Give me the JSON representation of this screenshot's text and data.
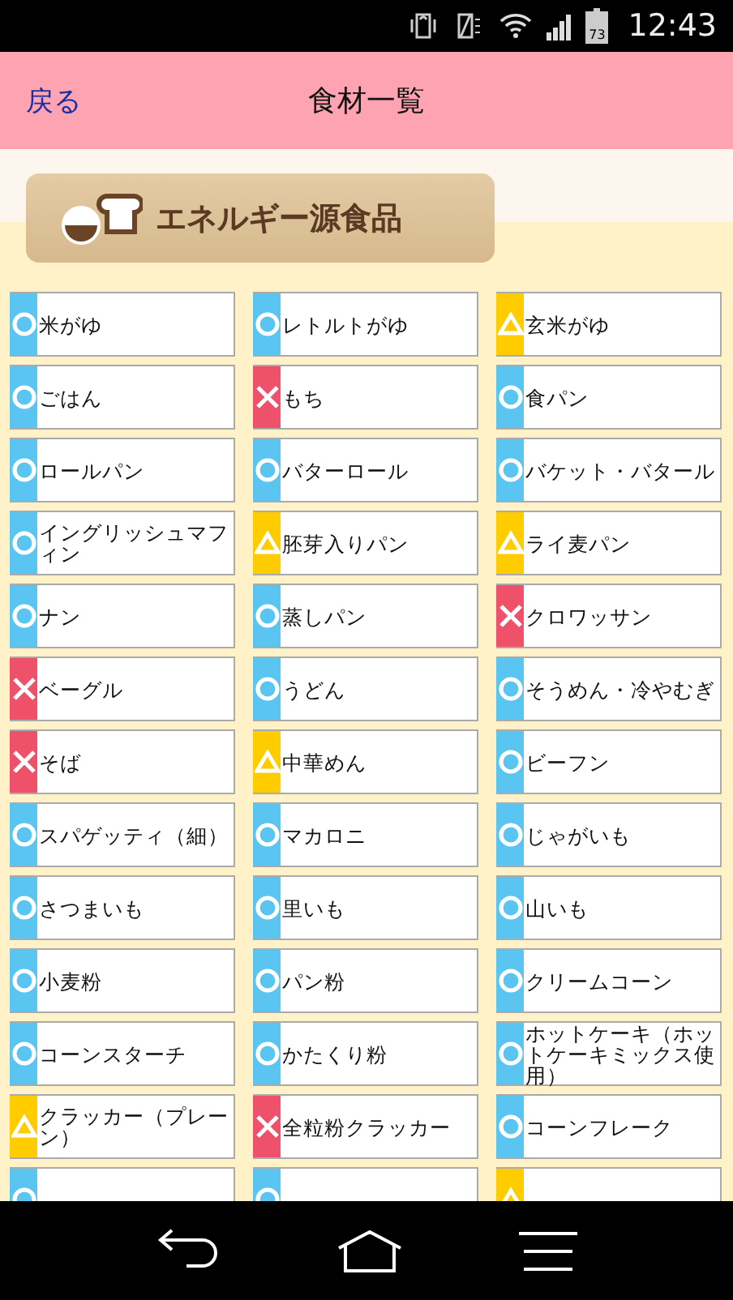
{
  "status_bar": {
    "battery": "73",
    "time": "12:43"
  },
  "header": {
    "back": "戻る",
    "title": "食材一覧"
  },
  "section": {
    "title": "エネルギー源食品"
  },
  "rows": [
    [
      {
        "name": "米がゆ",
        "kind": "ok"
      },
      {
        "name": "レトルトがゆ",
        "kind": "ok"
      },
      {
        "name": "玄米がゆ",
        "kind": "caution"
      }
    ],
    [
      {
        "name": "ごはん",
        "kind": "ok"
      },
      {
        "name": "もち",
        "kind": "ng"
      },
      {
        "name": "食パン",
        "kind": "ok"
      }
    ],
    [
      {
        "name": "ロールパン",
        "kind": "ok"
      },
      {
        "name": "バターロール",
        "kind": "ok"
      },
      {
        "name": "バケット・バタール",
        "kind": "ok"
      }
    ],
    [
      {
        "name": "イングリッシュマフィン",
        "kind": "ok"
      },
      {
        "name": "胚芽入りパン",
        "kind": "caution"
      },
      {
        "name": "ライ麦パン",
        "kind": "caution"
      }
    ],
    [
      {
        "name": "ナン",
        "kind": "ok"
      },
      {
        "name": "蒸しパン",
        "kind": "ok"
      },
      {
        "name": "クロワッサン",
        "kind": "ng"
      }
    ],
    [
      {
        "name": "ベーグル",
        "kind": "ng"
      },
      {
        "name": "うどん",
        "kind": "ok"
      },
      {
        "name": "そうめん・冷やむぎ",
        "kind": "ok"
      }
    ],
    [
      {
        "name": "そば",
        "kind": "ng"
      },
      {
        "name": "中華めん",
        "kind": "caution"
      },
      {
        "name": "ビーフン",
        "kind": "ok"
      }
    ],
    [
      {
        "name": "スパゲッティ（細）",
        "kind": "ok"
      },
      {
        "name": "マカロニ",
        "kind": "ok"
      },
      {
        "name": "じゃがいも",
        "kind": "ok"
      }
    ],
    [
      {
        "name": "さつまいも",
        "kind": "ok"
      },
      {
        "name": "里いも",
        "kind": "ok"
      },
      {
        "name": "山いも",
        "kind": "ok"
      }
    ],
    [
      {
        "name": "小麦粉",
        "kind": "ok"
      },
      {
        "name": "パン粉",
        "kind": "ok"
      },
      {
        "name": "クリームコーン",
        "kind": "ok"
      }
    ],
    [
      {
        "name": "コーンスターチ",
        "kind": "ok"
      },
      {
        "name": "かたくり粉",
        "kind": "ok"
      },
      {
        "name": "ホットケーキ（ホットケーキミックス使用）",
        "kind": "ok"
      }
    ],
    [
      {
        "name": "クラッカー（プレーン）",
        "kind": "caution"
      },
      {
        "name": "全粒粉クラッカー",
        "kind": "ng"
      },
      {
        "name": "コーンフレーク",
        "kind": "ok"
      }
    ],
    [
      {
        "kind": "ok"
      },
      {
        "kind": "ok"
      },
      {
        "kind": "caution"
      }
    ]
  ]
}
